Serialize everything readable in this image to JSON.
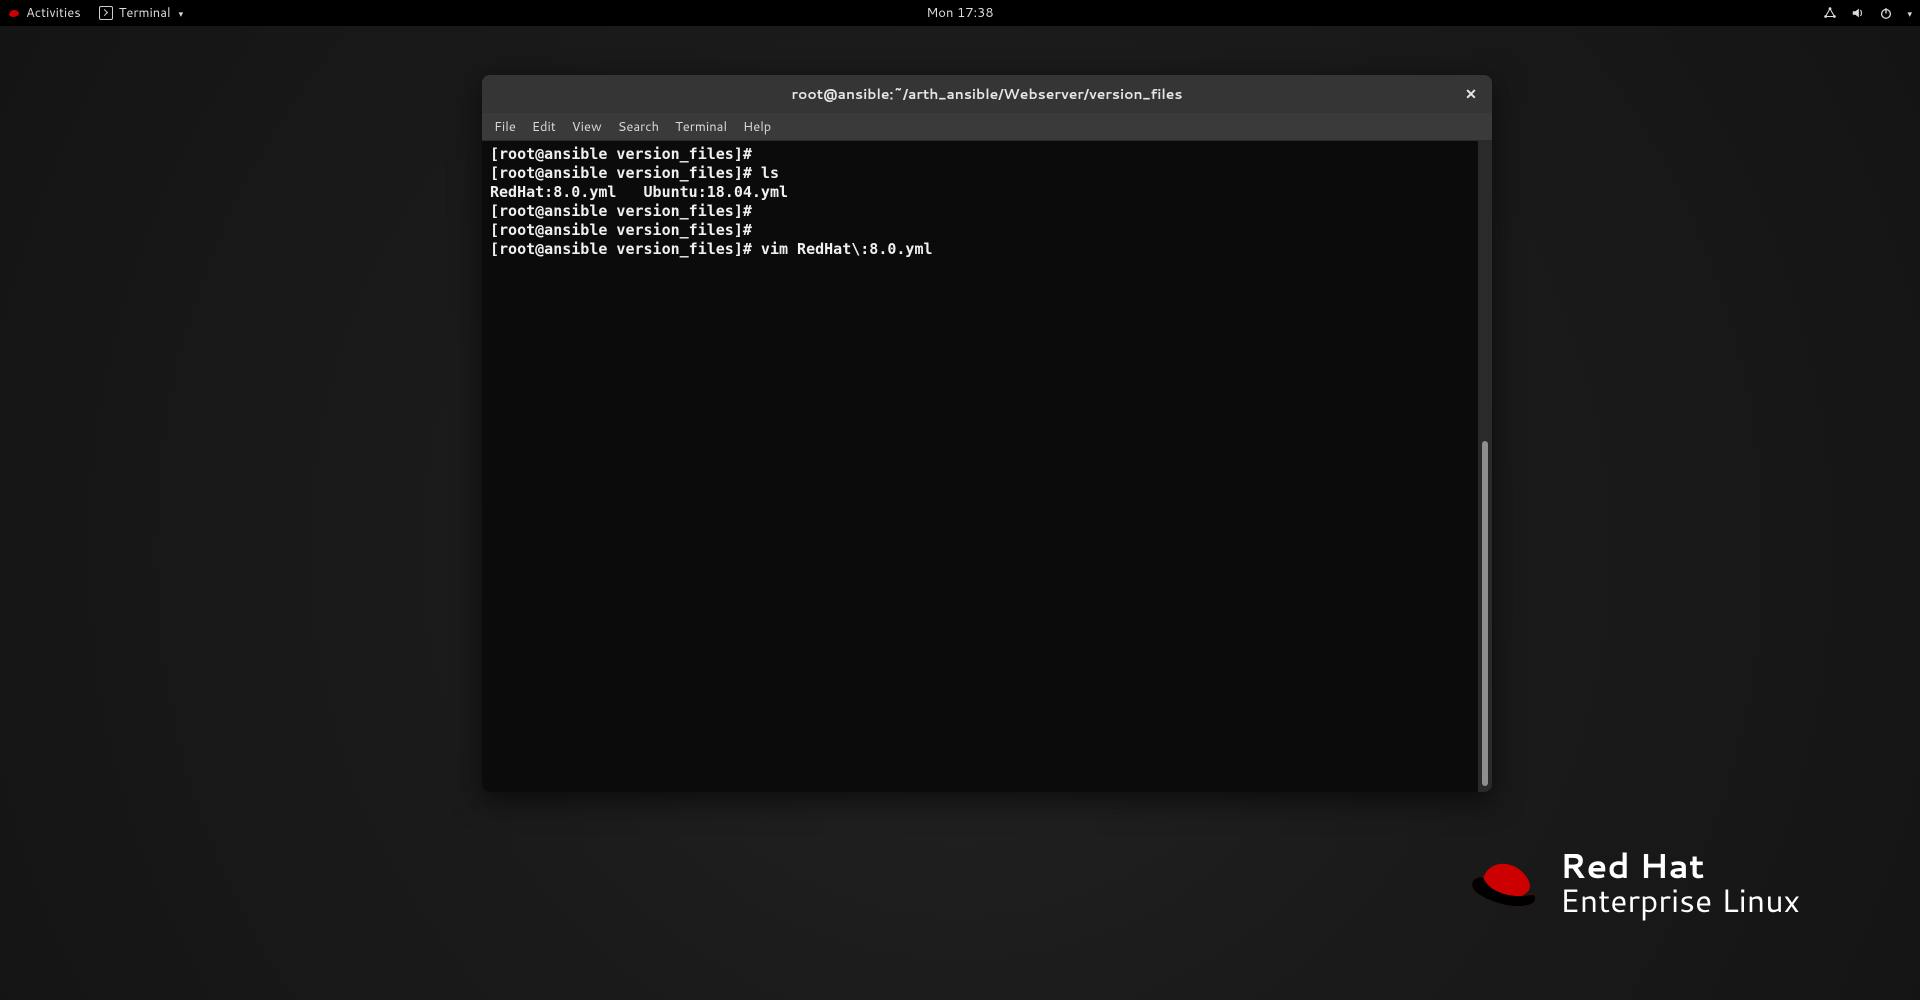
{
  "topbar": {
    "activities": "Activities",
    "app_name": "Terminal",
    "clock": "Mon 17:38"
  },
  "window": {
    "title": "root@ansible:~/arth_ansible/Webserver/version_files",
    "close_glyph": "✕",
    "menu": {
      "file": "File",
      "edit": "Edit",
      "view": "View",
      "search": "Search",
      "terminal": "Terminal",
      "help": "Help"
    }
  },
  "terminal": {
    "lines": [
      "[root@ansible version_files]#",
      "[root@ansible version_files]# ls",
      "RedHat:8.0.yml   Ubuntu:18.04.yml",
      "[root@ansible version_files]#",
      "[root@ansible version_files]#",
      "[root@ansible version_files]# vim RedHat\\:8.0.yml"
    ]
  },
  "brand": {
    "line1": "Red Hat",
    "line2": "Enterprise Linux"
  }
}
